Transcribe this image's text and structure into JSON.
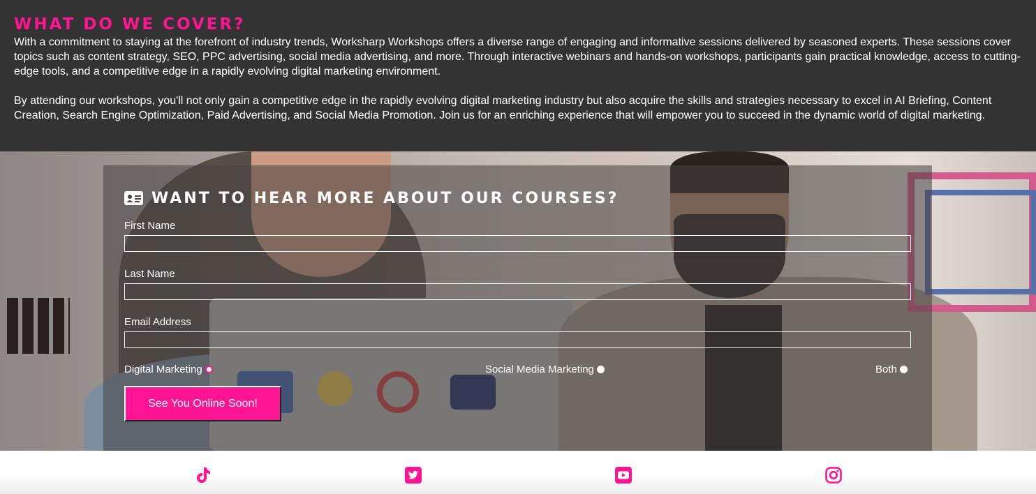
{
  "cover": {
    "heading": "WHAT DO WE COVER?",
    "paragraph_1": "With a commitment to staying at the forefront of industry trends, Worksharp Workshops offers a diverse range of engaging and informative sessions delivered by seasoned experts. These sessions cover topics such as content strategy, SEO, PPC advertising, social media advertising, and more. Through interactive webinars and hands-on workshops, participants gain practical knowledge, access to cutting-edge tools, and a competitive edge in a rapidly evolving digital marketing environment.",
    "paragraph_2": "By attending our workshops, you'll not only gain a competitive edge in the rapidly evolving digital marketing industry but also acquire the skills and strategies necessary to excel in AI Briefing, Content Creation, Search Engine Optimization, Paid Advertising, and Social Media Promotion. Join us for an enriching experience that will empower you to succeed in the dynamic world of digital marketing."
  },
  "form": {
    "title": "WANT TO HEAR MORE ABOUT OUR COURSES?",
    "title_icon": "address-card-icon",
    "fields": [
      {
        "label": "First Name",
        "value": ""
      },
      {
        "label": "Last Name",
        "value": ""
      },
      {
        "label": "Email Address",
        "value": ""
      }
    ],
    "options": [
      {
        "label": "Digital Marketing",
        "selected": true
      },
      {
        "label": "Social Media Marketing",
        "selected": false
      },
      {
        "label": "Both",
        "selected": false
      }
    ],
    "submit_label": "See You Online Soon!"
  },
  "social": {
    "icons": [
      "tiktok-icon",
      "twitter-icon",
      "youtube-icon",
      "instagram-icon"
    ]
  },
  "colors": {
    "accent": "#ff1493",
    "dark_bg": "#333333",
    "text_light": "#ffffff"
  }
}
